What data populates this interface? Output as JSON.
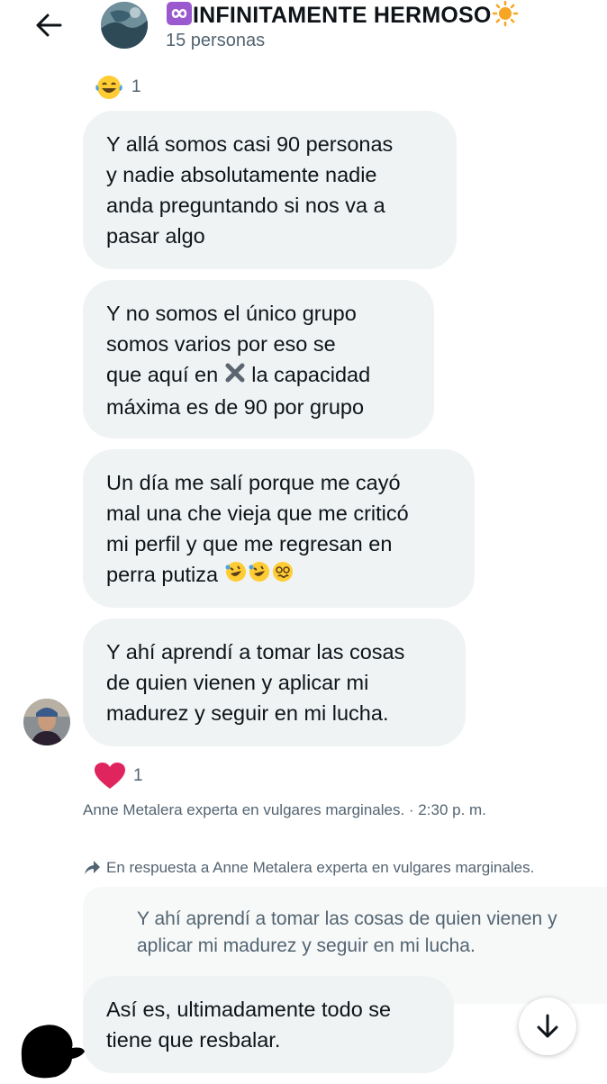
{
  "header": {
    "title": "INFINITAMENTE HERMOSO",
    "subtitle": "15 personas",
    "back_icon": "arrow-left-icon"
  },
  "reactions": {
    "top": {
      "emoji": "laughing-tears",
      "count": "1"
    },
    "heart": {
      "emoji": "red-heart",
      "count": "1"
    }
  },
  "messages": [
    {
      "lines": [
        "Y allá somos casi 90 personas",
        "y nadie absolutamente nadie",
        "anda preguntando si nos va a",
        "pasar algo"
      ]
    },
    {
      "lines": [
        "Y no somos el único grupo",
        "somos varios por eso se",
        "que aquí en",
        "la capacidad",
        "máxima es de 90 por grupo"
      ]
    },
    {
      "lines": [
        "Un día me salí porque me cayó",
        "mal una che vieja que me criticó",
        "mi perfil y que me regresan en",
        "perra putiza"
      ]
    },
    {
      "lines": [
        "Y ahí aprendí a tomar las cosas",
        "de quien vienen y aplicar mi",
        "madurez y seguir en mi lucha."
      ]
    }
  ],
  "sender_meta": "Anne Metalera experta en vulgares marginales. · 2:30 p. m.",
  "reply": {
    "context": "En respuesta a Anne Metalera experta en vulgares marginales.",
    "quoted_lines": [
      "Y ahí aprendí a tomar las cosas de quien vienen y",
      "aplicar mi madurez y seguir en mi lucha."
    ],
    "message_lines": [
      "Así es, ultimadamente todo se",
      "tiene que resbalar."
    ]
  },
  "colors": {
    "bubble": "#eff3f4",
    "secondary_text": "#536471",
    "heart": "#e0245e"
  }
}
